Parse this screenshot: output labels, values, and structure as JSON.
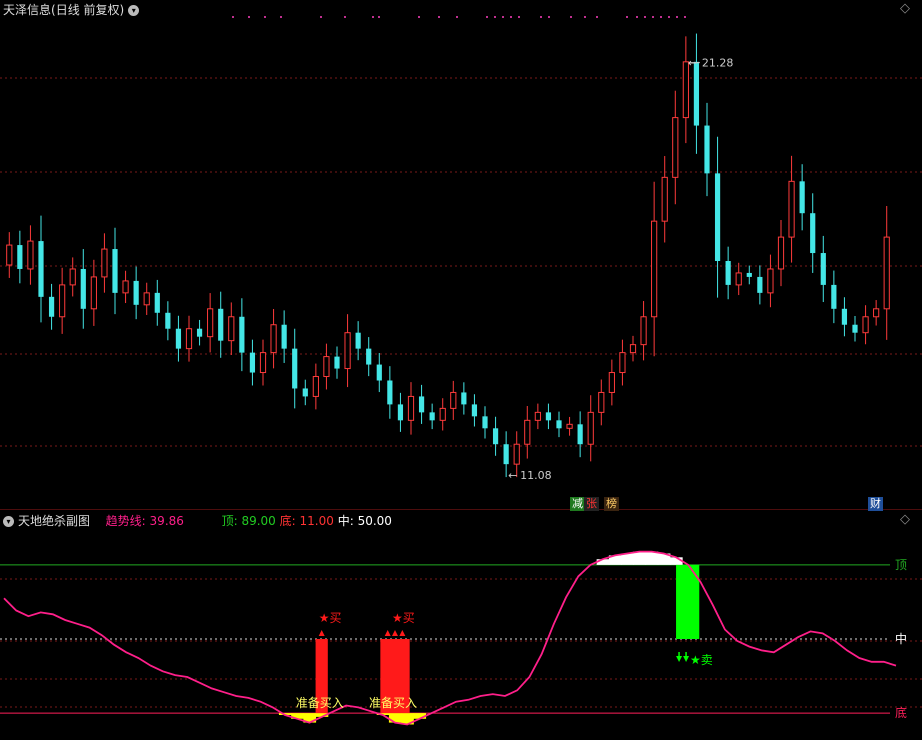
{
  "price_pane": {
    "stock_name": "天泽信息",
    "mode": "(日线 前复权)",
    "menu_icon": "chevron-down-icon",
    "corner_icon": "diamond-icon",
    "high_label": "21.28",
    "low_label": "11.08",
    "badges": [
      {
        "text": "减",
        "color": "#ffffff",
        "bg": "#1f7a1f"
      },
      {
        "text": "张",
        "color": "#ff3333",
        "bg": "#222222"
      },
      {
        "text": "榜",
        "color": "#ffcc66",
        "bg": "#3a2410"
      },
      {
        "text": "财",
        "color": "#ffffff",
        "bg": "#1f4f9a"
      }
    ]
  },
  "indicator_pane": {
    "title": "天地绝杀副图",
    "menu_icon": "chevron-down-icon",
    "corner_icon": "diamond-icon",
    "trend_label": "趋势线:",
    "trend_value": "39.86",
    "top_label": "顶:",
    "top_value": "89.00",
    "bottom_label": "底:",
    "bottom_value": "11.00",
    "mid_label": "中:",
    "mid_value": "50.00",
    "level_labels": {
      "top": "顶",
      "mid": "中",
      "bottom": "底"
    },
    "buy_label": "★买",
    "sell_label": "★卖",
    "prepare_label": "准备买入",
    "colors": {
      "trend": "#ff1f8a",
      "top": "#22aa22",
      "bottom": "#ff1f5a",
      "buy": "#ff1a1a",
      "sell": "#00ff00"
    }
  },
  "chart_data": {
    "type": "candlestick",
    "series": [
      {
        "values": [
          16.6,
          16.0,
          16.7,
          15.3,
          14.8,
          15.6,
          16.0,
          15.0,
          15.8,
          16.5,
          15.4,
          15.7,
          15.1,
          15.4,
          14.9,
          14.5,
          14.0,
          14.5,
          14.3,
          15.0,
          14.2,
          14.8,
          13.9,
          13.4,
          13.9,
          14.6,
          14.0,
          13.0,
          12.8,
          13.3,
          13.8,
          13.5,
          14.4,
          14.0,
          13.6,
          13.2,
          12.6,
          12.2,
          12.8,
          12.4,
          12.2,
          12.5,
          12.9,
          12.6,
          12.3,
          12.0,
          11.6,
          11.1,
          11.6,
          12.2,
          12.4,
          12.2,
          12.0,
          12.1,
          11.6,
          12.4,
          12.9,
          13.4,
          13.9,
          14.1,
          14.8,
          17.2,
          18.3,
          19.8,
          21.2,
          19.6,
          18.4,
          16.2,
          15.6,
          15.9,
          15.8,
          15.4,
          16.0,
          16.8,
          18.2,
          17.4,
          16.4,
          15.6,
          15.0,
          14.6,
          14.4,
          14.8,
          15.0,
          16.8
        ]
      }
    ],
    "high_label_value": 21.28,
    "low_label_value": 11.08,
    "indicator": {
      "trend_values": [
        71.5,
        65,
        62,
        64,
        63,
        60,
        58,
        56,
        52,
        47,
        43,
        40,
        36,
        33,
        31,
        30,
        27,
        24,
        22,
        20,
        19,
        17,
        14,
        10,
        8,
        6,
        9,
        12,
        15,
        14,
        12,
        10,
        6,
        5,
        8,
        11,
        14,
        17,
        18,
        20,
        21,
        20,
        23,
        30,
        42,
        58,
        72,
        83,
        89,
        92,
        94,
        95,
        96,
        96,
        95,
        93,
        89,
        80,
        68,
        55,
        49,
        46,
        44,
        43,
        47,
        51,
        54,
        53,
        49,
        44,
        40,
        38,
        38,
        36
      ],
      "top": 89,
      "middle": 50,
      "bottom": 11,
      "current_trend": 39.86,
      "buy_signals": 2,
      "sell_signals": 1
    }
  }
}
